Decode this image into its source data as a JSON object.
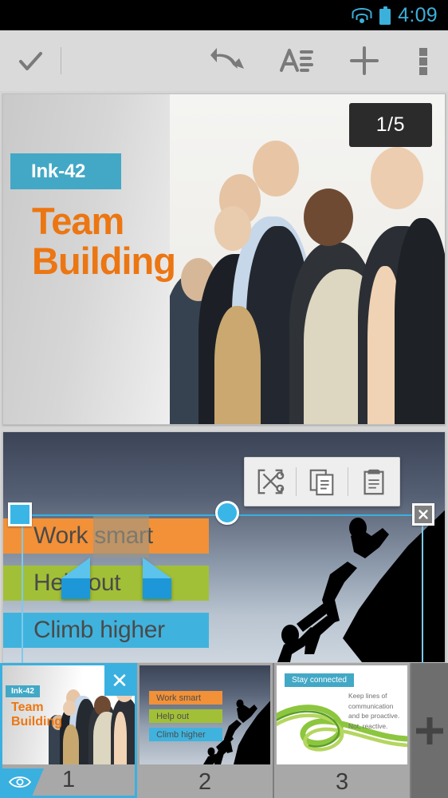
{
  "status_bar": {
    "time": "4:09",
    "wifi_icon": "wifi-icon",
    "battery_icon": "battery-icon",
    "accent_color": "#3ab0db"
  },
  "action_bar": {
    "done_label": "✓",
    "icons": {
      "done": "checkmark-icon",
      "undo": "undo-icon",
      "text_format": "text-format-icon",
      "add": "plus-icon",
      "overflow": "overflow-menu-icon"
    }
  },
  "slide_preview": {
    "page_indicator": "1/5",
    "title_badge": "Ink-42",
    "heading_line1": "Team",
    "heading_line2": "Building",
    "badge_color": "#42a8c6",
    "heading_color": "#ec7612"
  },
  "editor": {
    "selected_word": "smart",
    "text_lines": [
      {
        "text": "Work smart",
        "color": "#f29138"
      },
      {
        "text": "Help out",
        "color": "#a2c037"
      },
      {
        "text": "Climb higher",
        "color": "#3fb3dd"
      }
    ],
    "context_menu": {
      "cut": "cut-icon",
      "copy": "copy-icon",
      "paste": "paste-icon"
    },
    "handles": {
      "resize": "resize-handle",
      "rotate": "rotate-handle",
      "close": "close-icon",
      "selection_start": "selection-handle-left",
      "selection_end": "selection-handle-right"
    },
    "selection_color": "#3ab0e0"
  },
  "thumbnails": {
    "add_slide_label": "+",
    "slides": [
      {
        "number": "1",
        "badge": "Ink-42",
        "heading_line1": "Team",
        "heading_line2": "Building",
        "selected": true,
        "close_label": "✕",
        "visibility_icon": "eye-icon"
      },
      {
        "number": "2",
        "lines": [
          "Work smart",
          "Help out",
          "Climb higher"
        ],
        "selected": false
      },
      {
        "number": "3",
        "badge": "Stay connected",
        "body": "Keep lines of communication and be proactive. Not, reactive.",
        "selected": false
      }
    ]
  }
}
